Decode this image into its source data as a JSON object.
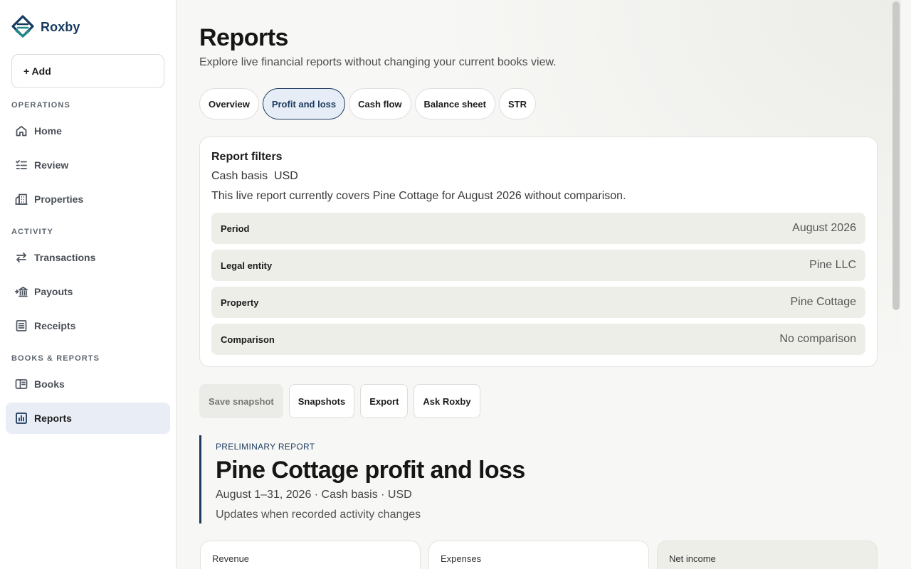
{
  "brand": {
    "name": "Roxby",
    "color": "#163a5f",
    "accent": "#1e8a8a"
  },
  "sidebar": {
    "add_label": "+ Add",
    "sections": [
      {
        "label": "OPERATIONS"
      },
      {
        "label": "ACTIVITY"
      },
      {
        "label": "BOOKS & REPORTS"
      }
    ],
    "items": [
      {
        "label": "Home",
        "icon": "home-icon"
      },
      {
        "label": "Review",
        "icon": "checklist-icon"
      },
      {
        "label": "Properties",
        "icon": "building-icon"
      },
      {
        "label": "Transactions",
        "icon": "arrows-swap-icon"
      },
      {
        "label": "Payouts",
        "icon": "bank-icon"
      },
      {
        "label": "Receipts",
        "icon": "receipt-icon"
      },
      {
        "label": "Books",
        "icon": "book-icon"
      },
      {
        "label": "Reports",
        "icon": "chart-icon",
        "active": true
      }
    ]
  },
  "header": {
    "title": "Reports",
    "subtitle": "Explore live financial reports without changing your current books view."
  },
  "tabs": [
    {
      "label": "Overview"
    },
    {
      "label": "Profit and loss",
      "active": true
    },
    {
      "label": "Cash flow"
    },
    {
      "label": "Balance sheet"
    },
    {
      "label": "STR"
    }
  ],
  "filters": {
    "title": "Report filters",
    "basis": "Cash basis  USD",
    "description": "This live report currently covers Pine Cottage for August 2026 without comparison.",
    "rows": [
      {
        "key": "Period",
        "value": "August 2026"
      },
      {
        "key": "Legal entity",
        "value": "Pine LLC"
      },
      {
        "key": "Property",
        "value": "Pine Cottage"
      },
      {
        "key": "Comparison",
        "value": "No comparison"
      }
    ]
  },
  "actions": {
    "save_snapshot": "Save snapshot",
    "snapshots": "Snapshots",
    "export": "Export",
    "ask": "Ask Roxby"
  },
  "report": {
    "eyebrow": "PRELIMINARY REPORT",
    "title": "Pine Cottage profit and loss",
    "meta": "August 1–31, 2026 · Cash basis · USD",
    "note": "Updates when recorded activity changes"
  },
  "metrics": [
    {
      "label": "Revenue"
    },
    {
      "label": "Expenses"
    },
    {
      "label": "Net income"
    }
  ],
  "colors": {
    "active_nav_bg": "#e9eef6",
    "active_tab_border": "#1d3a5f",
    "filter_row_bg": "#eeeee9"
  }
}
